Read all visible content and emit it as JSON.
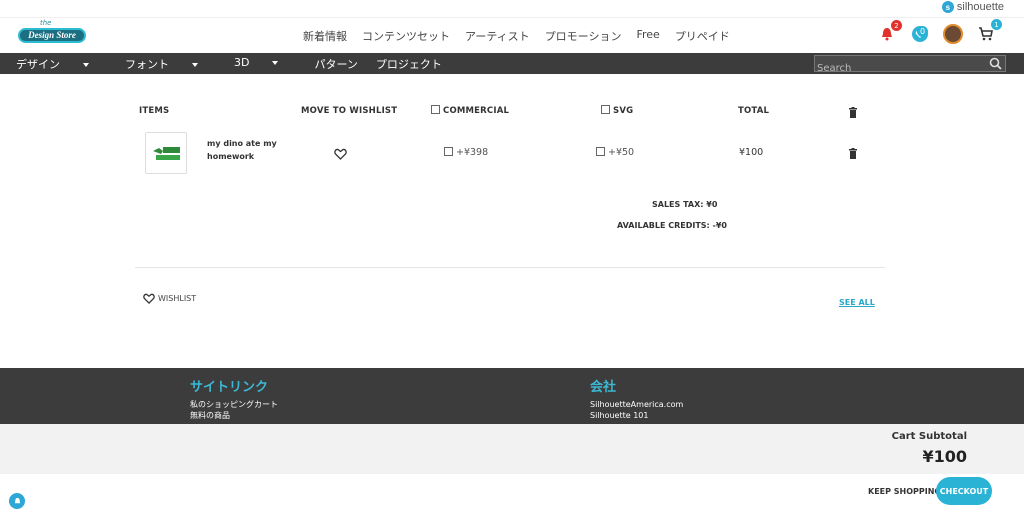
{
  "brand": {
    "name": "silhouette",
    "logo_small": "the",
    "logo_main": "Design Store"
  },
  "nav": {
    "items": [
      "新着情報",
      "コンテンツセット",
      "アーティスト",
      "プロモーション",
      "Free",
      "プリペイド"
    ]
  },
  "header_icons": {
    "notifications_count": "2",
    "wishlist_count": "0",
    "cart_count": "1"
  },
  "categories": {
    "items": [
      "デザイン",
      "フォント",
      "3D",
      "パターン",
      "プロジェクト"
    ]
  },
  "search": {
    "placeholder": "Search"
  },
  "cart": {
    "headers": {
      "items": "ITEMS",
      "move_to_wishlist": "MOVE TO WISHLIST",
      "commercial": "COMMERCIAL",
      "svg": "SVG",
      "total": "TOTAL"
    },
    "item": {
      "name": "my dino ate my homework",
      "thumb_text": "MY DINO ATE MY HOMEWORK",
      "commercial_price": "+¥398",
      "svg_price": "+¥50",
      "total": "¥100"
    },
    "sales_tax_label": "SALES TAX:",
    "sales_tax_value": "¥0",
    "credits_label": "AVAILABLE CREDITS:",
    "credits_value": "-¥0"
  },
  "wishlist": {
    "label": "WISHLIST",
    "see_all": "SEE ALL"
  },
  "footer": {
    "col1_title": "サイトリンク",
    "col1_links": [
      "私のショッピングカート",
      "無料の商品"
    ],
    "col2_title": "会社",
    "col2_links": [
      "SilhouetteAmerica.com",
      "Silhouette 101"
    ]
  },
  "summary": {
    "label": "Cart Subtotal",
    "value": "¥100",
    "keep_shopping": "KEEP SHOPPING",
    "checkout": "CHECKOUT"
  },
  "colors": {
    "accent": "#2bb3d6",
    "dark_bar": "#3c3c3c",
    "notif_badge": "#e0312b"
  }
}
